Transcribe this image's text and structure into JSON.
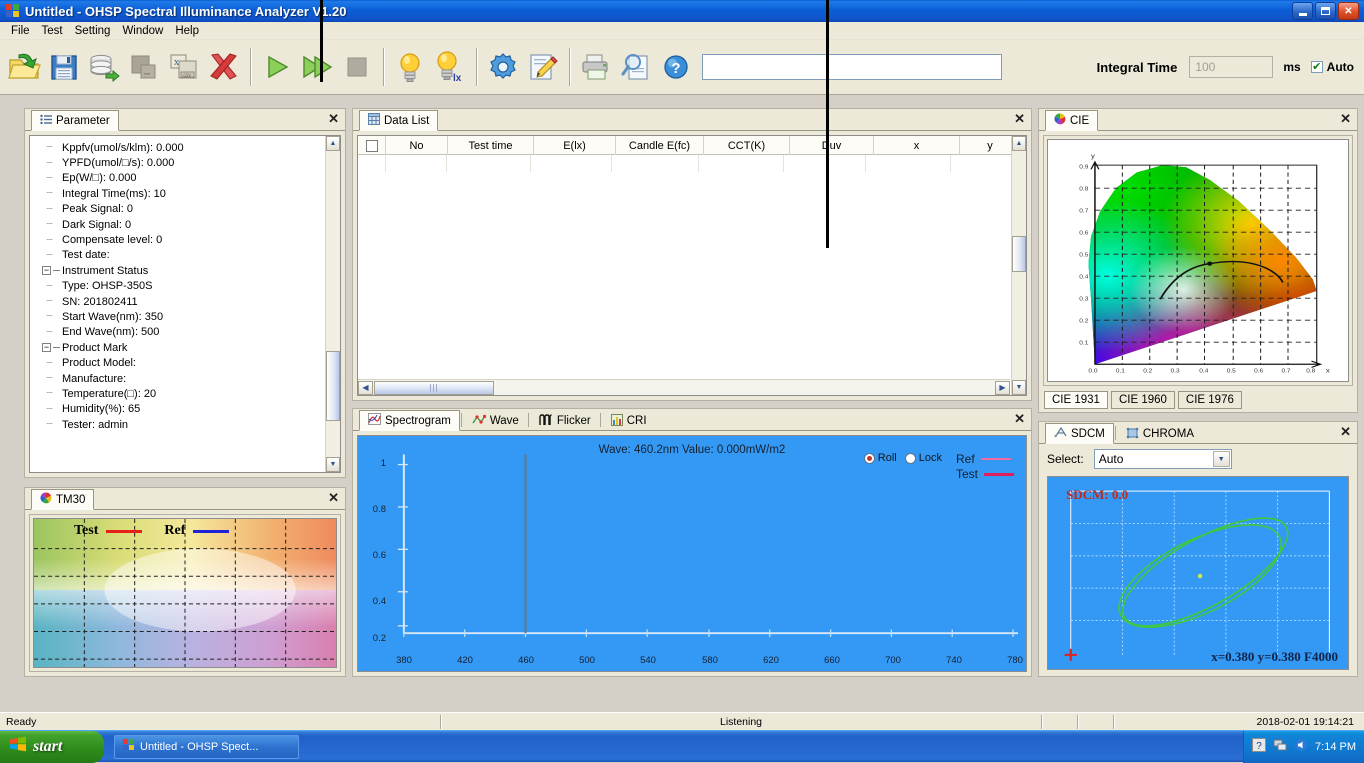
{
  "window": {
    "title": "Untitled - OHSP Spectral Illuminance Analyzer V1.20",
    "minimize": "_",
    "restore": "❐",
    "close": "✕"
  },
  "menu": {
    "items": [
      "File",
      "Test",
      "Setting",
      "Window",
      "Help"
    ]
  },
  "toolbar": {
    "icons": [
      {
        "name": "open-folder-icon",
        "glyph": "open"
      },
      {
        "name": "save-icon",
        "glyph": "save"
      },
      {
        "name": "database-export-icon",
        "glyph": "db"
      },
      {
        "name": "copy-icon",
        "glyph": "copy"
      },
      {
        "name": "excel-export-icon",
        "glyph": "excel"
      },
      {
        "name": "delete-icon",
        "glyph": "x"
      },
      {
        "name": "play-icon",
        "glyph": "play"
      },
      {
        "name": "play-continuous-icon",
        "glyph": "playplay"
      },
      {
        "name": "stop-icon",
        "glyph": "stop"
      },
      {
        "name": "lamp-icon",
        "glyph": "bulb"
      },
      {
        "name": "lamp-lx-icon",
        "glyph": "bulblx"
      },
      {
        "name": "settings-gear-icon",
        "glyph": "gear"
      },
      {
        "name": "edit-note-icon",
        "glyph": "edit"
      },
      {
        "name": "print-icon",
        "glyph": "print"
      },
      {
        "name": "print-preview-icon",
        "glyph": "preview"
      },
      {
        "name": "help-icon",
        "glyph": "help"
      }
    ],
    "search_value": "",
    "integral_time_label": "Integral Time",
    "integral_time_value": "100",
    "unit_label": "ms",
    "auto_label": "Auto",
    "auto_checked": "✔"
  },
  "parameter_panel": {
    "tab_label": "Parameter",
    "close": "✕",
    "items": [
      {
        "label": "Kppfv(umol/s/klm): 0.000",
        "type": "leaf"
      },
      {
        "label": "YPFD(umol/□/s): 0.000",
        "type": "leaf"
      },
      {
        "label": "Ep(W/□): 0.000",
        "type": "leaf"
      },
      {
        "label": "Integral Time(ms): 10",
        "type": "leaf"
      },
      {
        "label": "Peak Signal: 0",
        "type": "leaf"
      },
      {
        "label": "Dark Signal: 0",
        "type": "leaf"
      },
      {
        "label": "Compensate level: 0",
        "type": "leaf"
      },
      {
        "label": "Test date:",
        "type": "leaf"
      },
      {
        "label": "Instrument Status",
        "type": "group"
      },
      {
        "label": "Type: OHSP-350S",
        "type": "leaf"
      },
      {
        "label": "SN: 201802411",
        "type": "leaf"
      },
      {
        "label": "Start Wave(nm): 350",
        "type": "leaf"
      },
      {
        "label": "End Wave(nm): 500",
        "type": "leaf"
      },
      {
        "label": "Product Mark",
        "type": "group"
      },
      {
        "label": "Product Model:",
        "type": "leaf"
      },
      {
        "label": "Manufacture:",
        "type": "leaf"
      },
      {
        "label": "Temperature(□): 20",
        "type": "leaf"
      },
      {
        "label": "Humidity(%): 65",
        "type": "leaf"
      },
      {
        "label": "Tester: admin",
        "type": "leaf"
      }
    ]
  },
  "tm30_panel": {
    "tab_label": "TM30",
    "close": "✕",
    "legend": [
      {
        "label": "Test",
        "color": "#e8201a"
      },
      {
        "label": "Ref",
        "color": "#1f23d8"
      }
    ]
  },
  "data_list_panel": {
    "tab_label": "Data List",
    "close": "✕",
    "columns": [
      "",
      "No",
      "Test time",
      "E(lx)",
      "Candle E(fc)",
      "CCT(K)",
      "Duv",
      "x",
      "y"
    ],
    "rows": []
  },
  "spectrogram_panel": {
    "tabs": [
      {
        "label": "Spectrogram",
        "icon": "spectrogram-icon",
        "active": true
      },
      {
        "label": "Wave",
        "icon": "wave-icon",
        "active": false
      },
      {
        "label": "Flicker",
        "icon": "flicker-icon",
        "active": false
      },
      {
        "label": "CRI",
        "icon": "cri-icon",
        "active": false
      }
    ],
    "close": "✕",
    "radios": [
      {
        "label": "Roll",
        "selected": true
      },
      {
        "label": "Lock",
        "selected": false
      }
    ],
    "legend": [
      {
        "label": "Ref",
        "color": "#f06a9c"
      },
      {
        "label": "Test",
        "color": "#e01f5a"
      }
    ]
  },
  "cie_panel": {
    "tab_label": "CIE",
    "close": "✕",
    "tabs": [
      {
        "label": "CIE 1931",
        "active": true
      },
      {
        "label": "CIE 1960",
        "active": false
      },
      {
        "label": "CIE 1976",
        "active": false
      }
    ]
  },
  "sdcm_panel": {
    "tabs": [
      {
        "label": "SDCM",
        "icon": "sdcm-icon",
        "active": true
      },
      {
        "label": "CHROMA",
        "icon": "chroma-icon",
        "active": false
      }
    ],
    "close": "✕",
    "select_label": "Select:",
    "select_value": "Auto",
    "sdcm_value": "SDCM: 0.0",
    "coord_text": "x=0.380 y=0.380 F4000"
  },
  "statusbar": {
    "ready": "Ready",
    "listening": "Listening",
    "datetime": "2018-02-01 19:14:21"
  },
  "taskbar": {
    "start": "start",
    "task": "Untitled - OHSP Spect...",
    "time": "7:14 PM"
  },
  "chart_data": [
    {
      "type": "line",
      "name": "spectrogram",
      "title": "Wave: 460.2nm Value: 0.000mW/m2",
      "xlabel": "",
      "ylabel": "",
      "xlim": [
        380,
        790
      ],
      "ylim": [
        0.0,
        1.05
      ],
      "xticks": [
        380,
        420,
        460,
        500,
        540,
        580,
        620,
        660,
        700,
        740,
        780
      ],
      "yticks": [
        0.2,
        0.4,
        0.6,
        0.8,
        1.0
      ],
      "cursor_x": 460.2,
      "cursor_value": 0.0,
      "series": [
        {
          "name": "Ref",
          "color": "#f06a9c",
          "values": []
        },
        {
          "name": "Test",
          "color": "#e01f5a",
          "values": []
        }
      ],
      "grid": false,
      "legend_position": "top-right"
    },
    {
      "type": "scatter",
      "name": "cie-1931-chromaticity",
      "title": "",
      "xlabel": "x",
      "ylabel": "y",
      "xlim": [
        0.0,
        0.8
      ],
      "ylim": [
        0.0,
        0.9
      ],
      "xticks": [
        0.0,
        0.1,
        0.2,
        0.3,
        0.4,
        0.5,
        0.6,
        0.7,
        0.8
      ],
      "yticks": [
        0.1,
        0.2,
        0.3,
        0.4,
        0.5,
        0.6,
        0.7,
        0.8,
        0.9
      ],
      "grid": true,
      "annotations": [
        "planckian-locus"
      ],
      "points": []
    },
    {
      "type": "scatter",
      "name": "sdcm-macadam-ellipse",
      "title": "SDCM: 0.0",
      "xlabel": "x",
      "ylabel": "y",
      "grid": true,
      "points": [
        {
          "x": 0.38,
          "y": 0.38,
          "label": "F4000"
        }
      ],
      "ellipse_color": "#3ec93e"
    },
    {
      "type": "scatter",
      "name": "tm30-color-vector-graphic",
      "title": "",
      "series": [
        {
          "name": "Test",
          "color": "#e8201a",
          "values": []
        },
        {
          "name": "Ref",
          "color": "#1f23d8",
          "values": []
        }
      ],
      "grid": true,
      "points": []
    }
  ]
}
